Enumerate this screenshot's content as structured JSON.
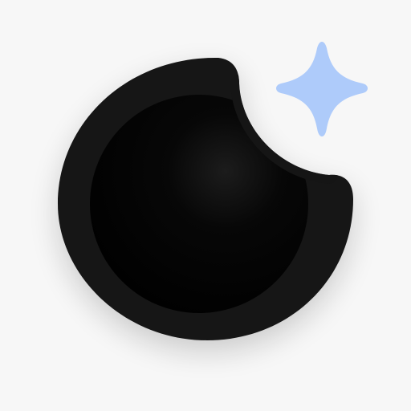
{
  "icon": {
    "name": "moon-sparkle-app-icon",
    "colors": {
      "background": "#f7f7f7",
      "moon_outer": "#151515",
      "moon_inner": "#050505",
      "sparkle": "#aecbfa"
    }
  }
}
